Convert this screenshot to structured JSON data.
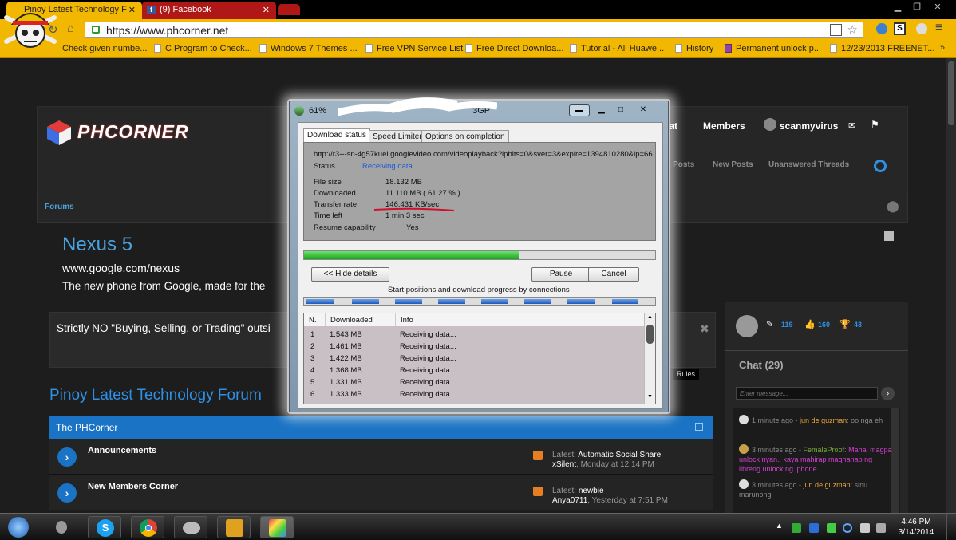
{
  "browser": {
    "tabs": [
      {
        "label": "Pinoy Latest Technology F"
      },
      {
        "label": "(9) Facebook"
      }
    ],
    "url": "https://www.phcorner.net",
    "bookmarks": [
      "Check given numbe...",
      "C Program to Check...",
      "Windows 7 Themes ...",
      "Free VPN Service List",
      "Free Direct Downloa...",
      "Tutorial - All Huawe...",
      "History",
      "Permanent unlock p...",
      "12/23/2013 FREENET..."
    ]
  },
  "site": {
    "logo": "PHCORNER",
    "nav": {
      "chat": "hat",
      "members": "Members",
      "user": "scanmyvirus"
    },
    "subnav": {
      "posts": "t Posts",
      "new_posts": "New Posts",
      "unanswered": "Unanswered Threads"
    },
    "breadcrumb": "Forums",
    "ad": {
      "title": "Nexus 5",
      "url": "www.google.com/nexus",
      "text": "The new phone from Google, made for the"
    },
    "notice": "Strictly NO \"Buying, Selling, or Trading\" outsi",
    "rules_label": "Rules",
    "forum_title": "Pinoy Latest Technology Forum",
    "category": "The PHCorner",
    "forums": [
      {
        "title": "Announcements",
        "latest_label": "Latest:",
        "latest_title": "Automatic Social Share",
        "latest_by": "xSilent",
        "latest_time": ", Monday at 12:14 PM"
      },
      {
        "title": "New Members Corner",
        "latest_label": "Latest:",
        "latest_title": "newbie",
        "latest_by": "Anya0711",
        "latest_time": ", Yesterday at 7:51 PM"
      }
    ],
    "user_stats": {
      "posts": "119",
      "likes": "160",
      "trophies": "43"
    },
    "chat": {
      "title": "Chat (29)",
      "placeholder": "Enter message...",
      "messages": [
        {
          "time": "1 minute ago - ",
          "user": "jun de guzman",
          "text": ": oo nga eh"
        },
        {
          "time": "3 minutes ago - ",
          "user": "FemaleProof",
          "text": ": Mahal magpa unlock nyan.. kaya mahirap maghanap ng libreng unlock ng iphone"
        },
        {
          "time": "3 minutes ago - ",
          "user": "jun de guzman",
          "text": ": sinu marunong"
        }
      ]
    }
  },
  "download": {
    "title": "61%",
    "title_tail": "3GP",
    "tabs": [
      "Download status",
      "Speed Limiter",
      "Options on completion"
    ],
    "url": "http://r3---sn-4g57kuel.googlevideo.com/videoplayback?ipbits=0&sver=3&expire=1394810280&ip=66.22",
    "fields": [
      {
        "label": "Status",
        "value": "Receiving data..."
      },
      {
        "label": "File size",
        "value": "18.132  MB"
      },
      {
        "label": "Downloaded",
        "value": "11.110  MB  ( 61.27 % )"
      },
      {
        "label": "Transfer rate",
        "value": "146.431  KB/sec"
      },
      {
        "label": "Time left",
        "value": "1 min 3 sec"
      },
      {
        "label": "Resume capability",
        "value": "Yes"
      }
    ],
    "progress": 0.6127,
    "buttons": {
      "details": "<< Hide details",
      "pause": "Pause",
      "cancel": "Cancel"
    },
    "connections_label": "Start positions and download progress by connections",
    "columns": [
      "N.",
      "Downloaded",
      "Info"
    ],
    "connections": [
      {
        "n": "1",
        "downloaded": "1.543  MB",
        "info": "Receiving data..."
      },
      {
        "n": "2",
        "downloaded": "1.461  MB",
        "info": "Receiving data..."
      },
      {
        "n": "3",
        "downloaded": "1.422  MB",
        "info": "Receiving data..."
      },
      {
        "n": "4",
        "downloaded": "1.368  MB",
        "info": "Receiving data..."
      },
      {
        "n": "5",
        "downloaded": "1.331  MB",
        "info": "Receiving data..."
      },
      {
        "n": "6",
        "downloaded": "1.333  MB",
        "info": "Receiving data..."
      }
    ]
  },
  "taskbar": {
    "time": "4:46 PM",
    "date": "3/14/2014",
    "apps": [
      "alienware-icon",
      "skype-icon",
      "chrome-icon",
      "network-icon",
      "idm-icon",
      "paint-icon"
    ]
  }
}
